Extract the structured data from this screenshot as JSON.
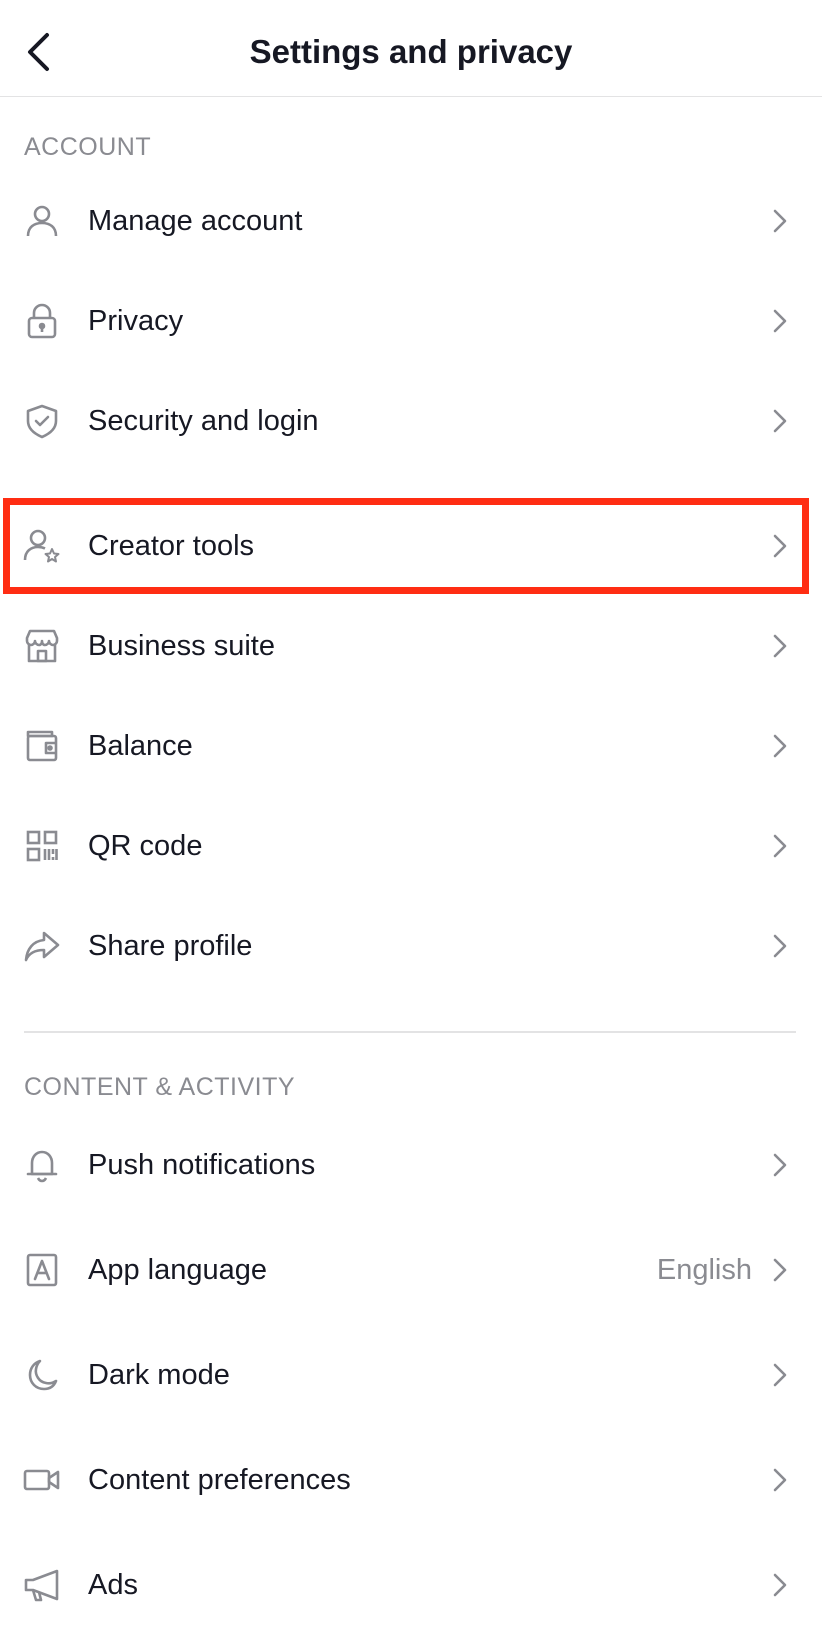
{
  "header": {
    "title": "Settings and privacy"
  },
  "sections": {
    "account": {
      "title": "ACCOUNT",
      "items": [
        {
          "label": "Manage account",
          "icon": "person-icon"
        },
        {
          "label": "Privacy",
          "icon": "lock-icon"
        },
        {
          "label": "Security and login",
          "icon": "shield-check-icon"
        },
        {
          "label": "Creator tools",
          "icon": "person-star-icon"
        },
        {
          "label": "Business suite",
          "icon": "storefront-icon"
        },
        {
          "label": "Balance",
          "icon": "wallet-icon"
        },
        {
          "label": "QR code",
          "icon": "qr-code-icon"
        },
        {
          "label": "Share profile",
          "icon": "share-arrow-icon"
        }
      ]
    },
    "content_activity": {
      "title": "CONTENT & ACTIVITY",
      "items": [
        {
          "label": "Push notifications",
          "icon": "bell-icon"
        },
        {
          "label": "App language",
          "icon": "language-a-icon",
          "value": "English"
        },
        {
          "label": "Dark mode",
          "icon": "moon-icon"
        },
        {
          "label": "Content preferences",
          "icon": "video-camera-icon"
        },
        {
          "label": "Ads",
          "icon": "megaphone-icon"
        }
      ]
    }
  },
  "highlight": {
    "target": "Creator tools",
    "color": "#ff2d13"
  },
  "colors": {
    "text": "#161823",
    "secondary": "#8a8b91",
    "divider": "#e3e3e4"
  }
}
